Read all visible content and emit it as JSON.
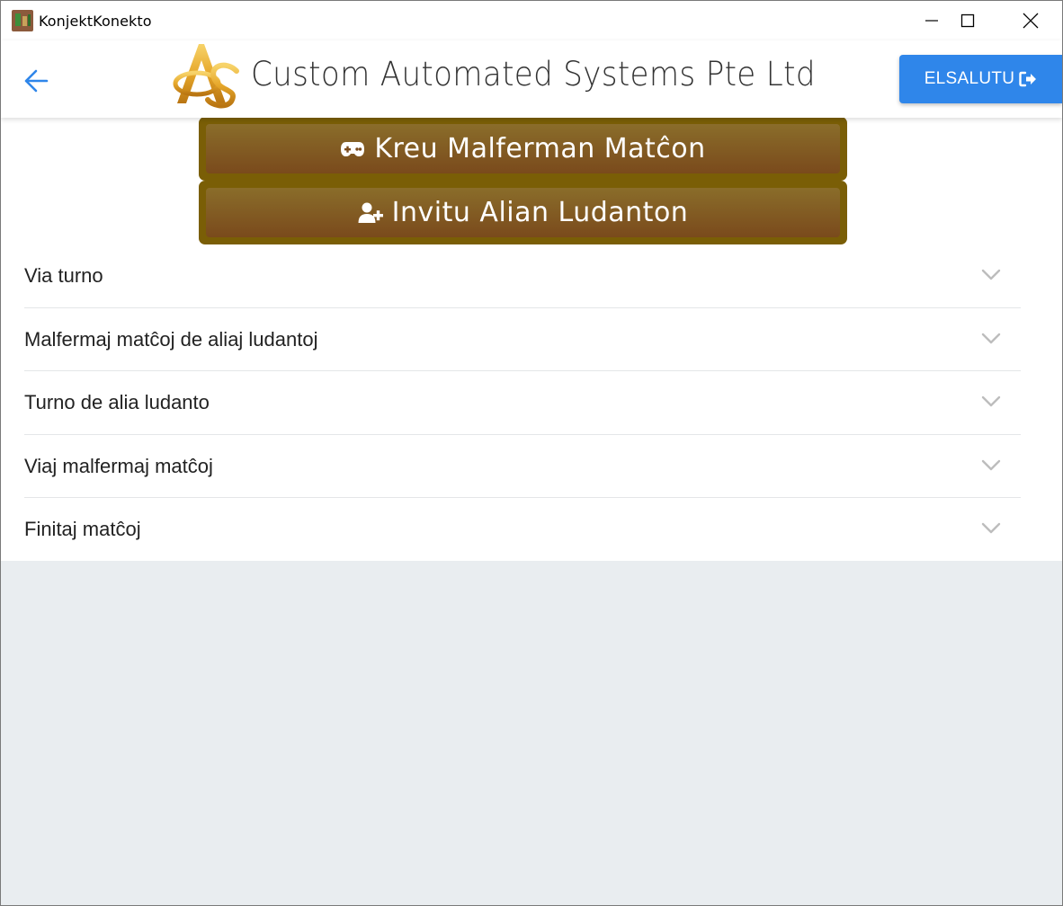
{
  "window": {
    "title": "KonjektKonekto",
    "controls": {
      "minimize": "minimize-icon",
      "maximize": "maximize-icon",
      "close": "close-icon"
    }
  },
  "header": {
    "back_icon": "arrow-left-icon",
    "logo_text": "AS",
    "company_name": "Custom Automated Systems Pte Ltd",
    "logout_label": "ELSALUTU",
    "logout_icon": "sign-out-icon"
  },
  "actions": [
    {
      "icon": "gamepad-icon",
      "label": "Kreu Malferman Matĉon"
    },
    {
      "icon": "user-plus-icon",
      "label": "Invitu Alian Ludanton"
    }
  ],
  "accordion": [
    {
      "label": "Via turno"
    },
    {
      "label": "Malfermaj matĉoj de aliaj ludantoj"
    },
    {
      "label": "Turno de alia ludanto"
    },
    {
      "label": "Viaj malfermaj matĉoj"
    },
    {
      "label": "Finitaj matĉoj"
    }
  ],
  "colors": {
    "accent": "#2f86ea",
    "action_button_border": "#7a5e06",
    "action_button_fill_top": "#8a6d2a",
    "action_button_fill_bottom": "#7a4a1c",
    "page_background": "#e9edf0"
  }
}
